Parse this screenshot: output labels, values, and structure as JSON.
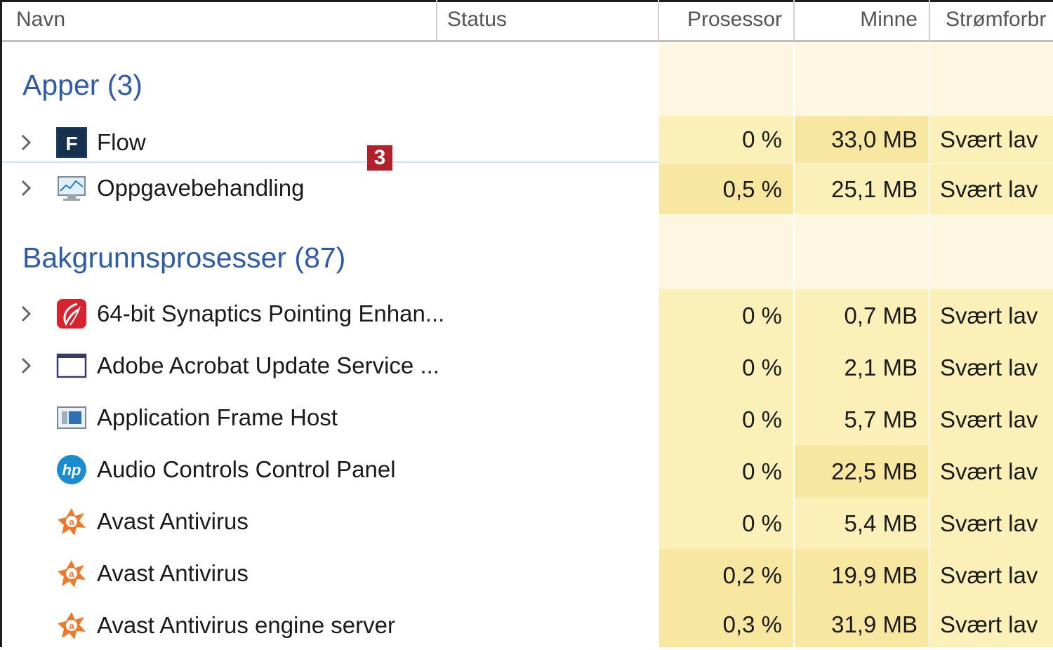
{
  "columns": {
    "name": "Navn",
    "status": "Status",
    "cpu": "Prosessor",
    "memory": "Minne",
    "power": "Strømforbr"
  },
  "callout_badge": "3",
  "groups": {
    "apps": {
      "title": "Apper (3)",
      "rows": [
        {
          "name": "Flow",
          "icon": "flow-app-icon",
          "cpu": "0 %",
          "memory": "33,0 MB",
          "power": "Svært lav",
          "expandable": true
        },
        {
          "name": "Oppgavebehandling",
          "icon": "task-manager-icon",
          "cpu": "0,5 %",
          "memory": "25,1 MB",
          "power": "Svært lav",
          "expandable": true
        }
      ]
    },
    "background": {
      "title": "Bakgrunnsprosesser (87)",
      "rows": [
        {
          "name": "64-bit Synaptics Pointing Enhan...",
          "icon": "synaptics-icon",
          "cpu": "0 %",
          "memory": "0,7 MB",
          "power": "Svært lav",
          "expandable": true
        },
        {
          "name": "Adobe Acrobat Update Service ...",
          "icon": "window-icon",
          "cpu": "0 %",
          "memory": "2,1 MB",
          "power": "Svært lav",
          "expandable": true
        },
        {
          "name": "Application Frame Host",
          "icon": "app-frame-icon",
          "cpu": "0 %",
          "memory": "5,7 MB",
          "power": "Svært lav",
          "expandable": false
        },
        {
          "name": "Audio Controls Control Panel",
          "icon": "hp-icon",
          "cpu": "0 %",
          "memory": "22,5 MB",
          "power": "Svært lav",
          "expandable": false
        },
        {
          "name": "Avast Antivirus",
          "icon": "avast-icon",
          "cpu": "0 %",
          "memory": "5,4 MB",
          "power": "Svært lav",
          "expandable": false
        },
        {
          "name": "Avast Antivirus",
          "icon": "avast-icon",
          "cpu": "0,2 %",
          "memory": "19,9 MB",
          "power": "Svært lav",
          "expandable": false
        },
        {
          "name": "Avast Antivirus engine server",
          "icon": "avast-icon",
          "cpu": "0,3 %",
          "memory": "31,9 MB",
          "power": "Svært lav",
          "expandable": false
        }
      ]
    }
  },
  "colors": {
    "group_title": "#2e5aa8",
    "heat_light": "#fbf2c9",
    "heat_medium": "#f9eaa9",
    "heat_strong": "#f6e39a",
    "group_band": "#fdf6e0",
    "badge": "#b4202a"
  }
}
